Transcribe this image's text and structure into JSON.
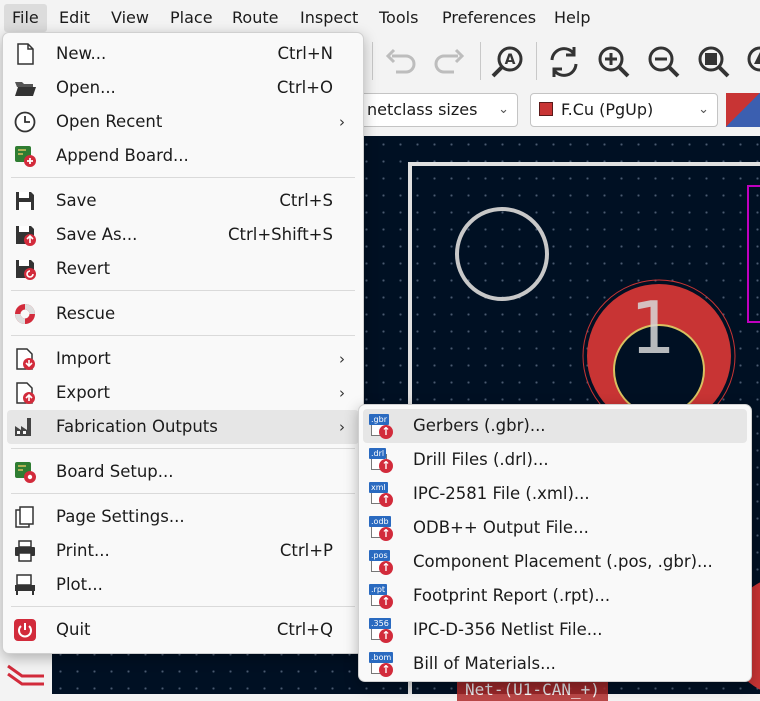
{
  "menubar": {
    "items": [
      "File",
      "Edit",
      "View",
      "Place",
      "Route",
      "Inspect",
      "Tools",
      "Preferences",
      "Help"
    ]
  },
  "toolbar2": {
    "netclass_combo": "netclass sizes",
    "layer_combo": "F.Cu (PgUp)"
  },
  "canvas": {
    "pad_number": "1",
    "net_label": "Net-(U1-CAN_+)"
  },
  "colors": {
    "board_bg": "#001023",
    "pad_red": "#c83434",
    "accent_blue": "#2a6ac0",
    "icon_red": "#d22b3b",
    "magenta_outline": "#c000c0"
  },
  "file_menu": {
    "items": [
      {
        "label": "New...",
        "shortcut": "Ctrl+N",
        "icon": "new-file-icon"
      },
      {
        "label": "Open...",
        "shortcut": "Ctrl+O",
        "icon": "folder-open-icon"
      },
      {
        "label": "Open Recent",
        "shortcut": "",
        "icon": "clock-icon",
        "submenu": true
      },
      {
        "label": "Append Board...",
        "shortcut": "",
        "icon": "append-board-icon"
      },
      {
        "label": "Save",
        "shortcut": "Ctrl+S",
        "icon": "save-icon"
      },
      {
        "label": "Save As...",
        "shortcut": "Ctrl+Shift+S",
        "icon": "save-as-icon"
      },
      {
        "label": "Revert",
        "shortcut": "",
        "icon": "revert-icon"
      },
      {
        "label": "Rescue",
        "shortcut": "",
        "icon": "rescue-icon"
      },
      {
        "label": "Import",
        "shortcut": "",
        "icon": "import-icon",
        "submenu": true
      },
      {
        "label": "Export",
        "shortcut": "",
        "icon": "export-icon",
        "submenu": true
      },
      {
        "label": "Fabrication Outputs",
        "shortcut": "",
        "icon": "factory-icon",
        "submenu": true
      },
      {
        "label": "Board Setup...",
        "shortcut": "",
        "icon": "board-setup-icon"
      },
      {
        "label": "Page Settings...",
        "shortcut": "",
        "icon": "page-settings-icon"
      },
      {
        "label": "Print...",
        "shortcut": "Ctrl+P",
        "icon": "printer-icon"
      },
      {
        "label": "Plot...",
        "shortcut": "",
        "icon": "plotter-icon"
      },
      {
        "label": "Quit",
        "shortcut": "Ctrl+Q",
        "icon": "power-icon"
      }
    ]
  },
  "fab_submenu": {
    "items": [
      {
        "label": "Gerbers (.gbr)...",
        "tag": ".gbr"
      },
      {
        "label": "Drill Files (.drl)...",
        "tag": ".drl"
      },
      {
        "label": "IPC-2581 File (.xml)...",
        "tag": "xml"
      },
      {
        "label": "ODB++ Output File...",
        "tag": ".odb"
      },
      {
        "label": "Component Placement (.pos, .gbr)...",
        "tag": ".pos"
      },
      {
        "label": "Footprint Report (.rpt)...",
        "tag": ".rpt"
      },
      {
        "label": "IPC-D-356 Netlist File...",
        "tag": ".356"
      },
      {
        "label": "Bill of Materials...",
        "tag": ".bom"
      }
    ]
  }
}
